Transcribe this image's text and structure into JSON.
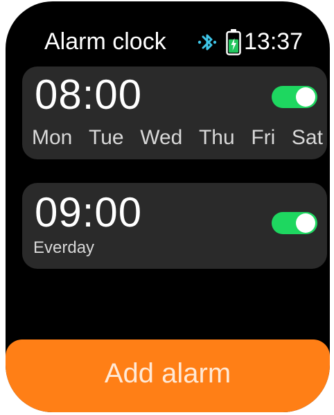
{
  "status_bar": {
    "title": "Alarm clock",
    "time": "13:37",
    "bluetooth_icon": "bluetooth-icon",
    "battery_icon": "battery-charging-icon",
    "battery_level": 0.8
  },
  "alarms": [
    {
      "time": "08:00",
      "enabled": true,
      "days": [
        "Mon",
        "Tue",
        "Wed",
        "Thu",
        "Fri",
        "Sat"
      ]
    },
    {
      "time": "09:00",
      "enabled": true,
      "repeat": "Everday"
    }
  ],
  "add_button": {
    "label": "Add alarm"
  },
  "colors": {
    "background": "#000000",
    "card": "#2a2a2a",
    "toggle_on": "#1ed760",
    "accent": "#ff7f16",
    "bluetooth": "#3fc6e8",
    "battery": "#22c55e"
  }
}
